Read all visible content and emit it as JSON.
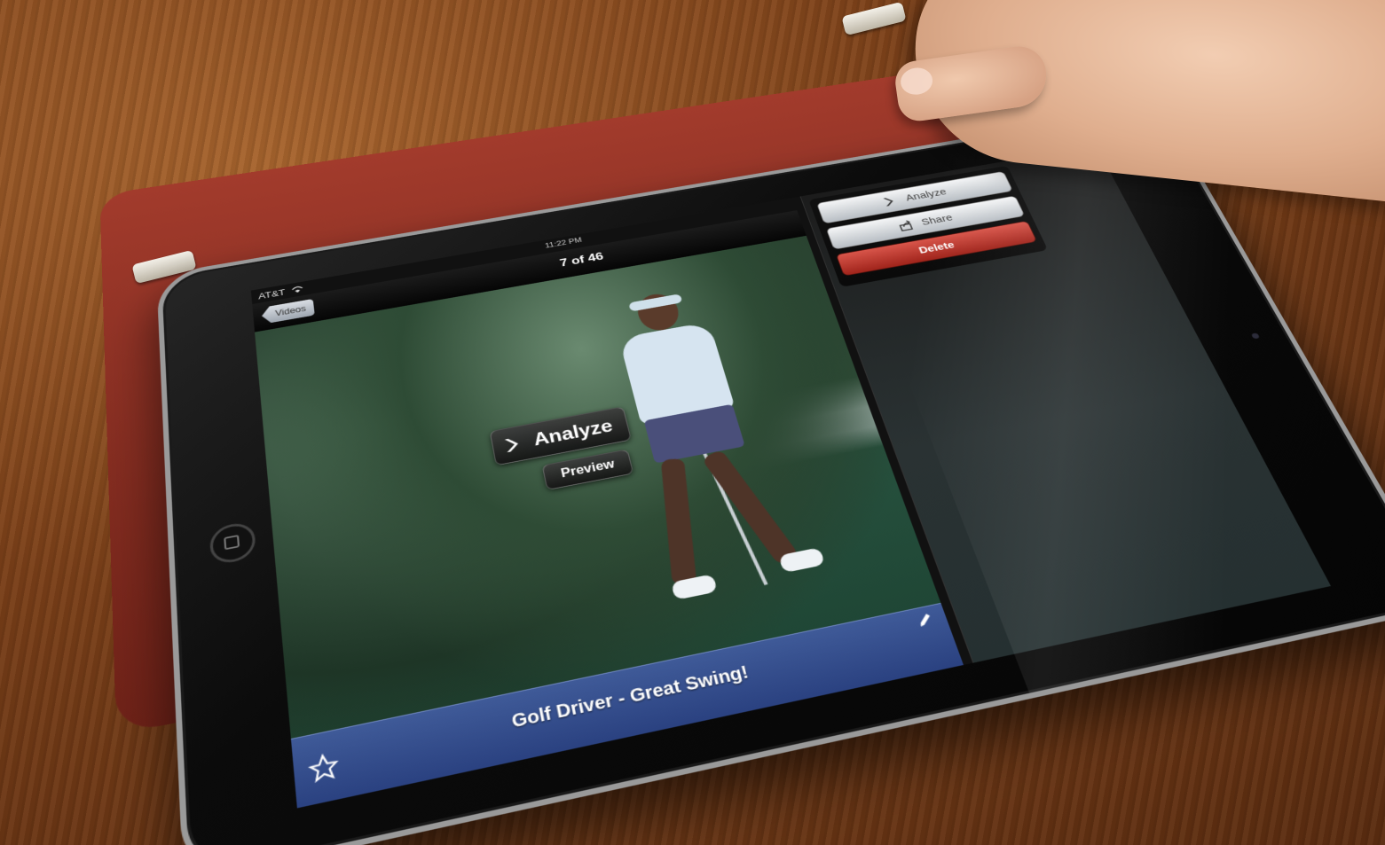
{
  "status_bar": {
    "carrier": "AT&T",
    "time": "11:22 PM"
  },
  "nav_bar": {
    "back_label": "Videos",
    "counter": "7 of 46"
  },
  "video": {
    "analyze_overlay": "Analyze",
    "preview_overlay": "Preview",
    "caption": "Golf Driver - Great Swing!"
  },
  "action_menu": {
    "analyze": "Analyze",
    "share": "Share",
    "delete": "Delete"
  },
  "colors": {
    "caption_bar": "#2a4180",
    "delete_button": "#a0241b",
    "device_cover": "#a23b2c"
  },
  "icons": {
    "analyze": "chevron-arrows-icon",
    "share": "share-icon",
    "favorite": "star-icon",
    "edit": "pencil-icon",
    "wifi": "wifi-icon"
  }
}
